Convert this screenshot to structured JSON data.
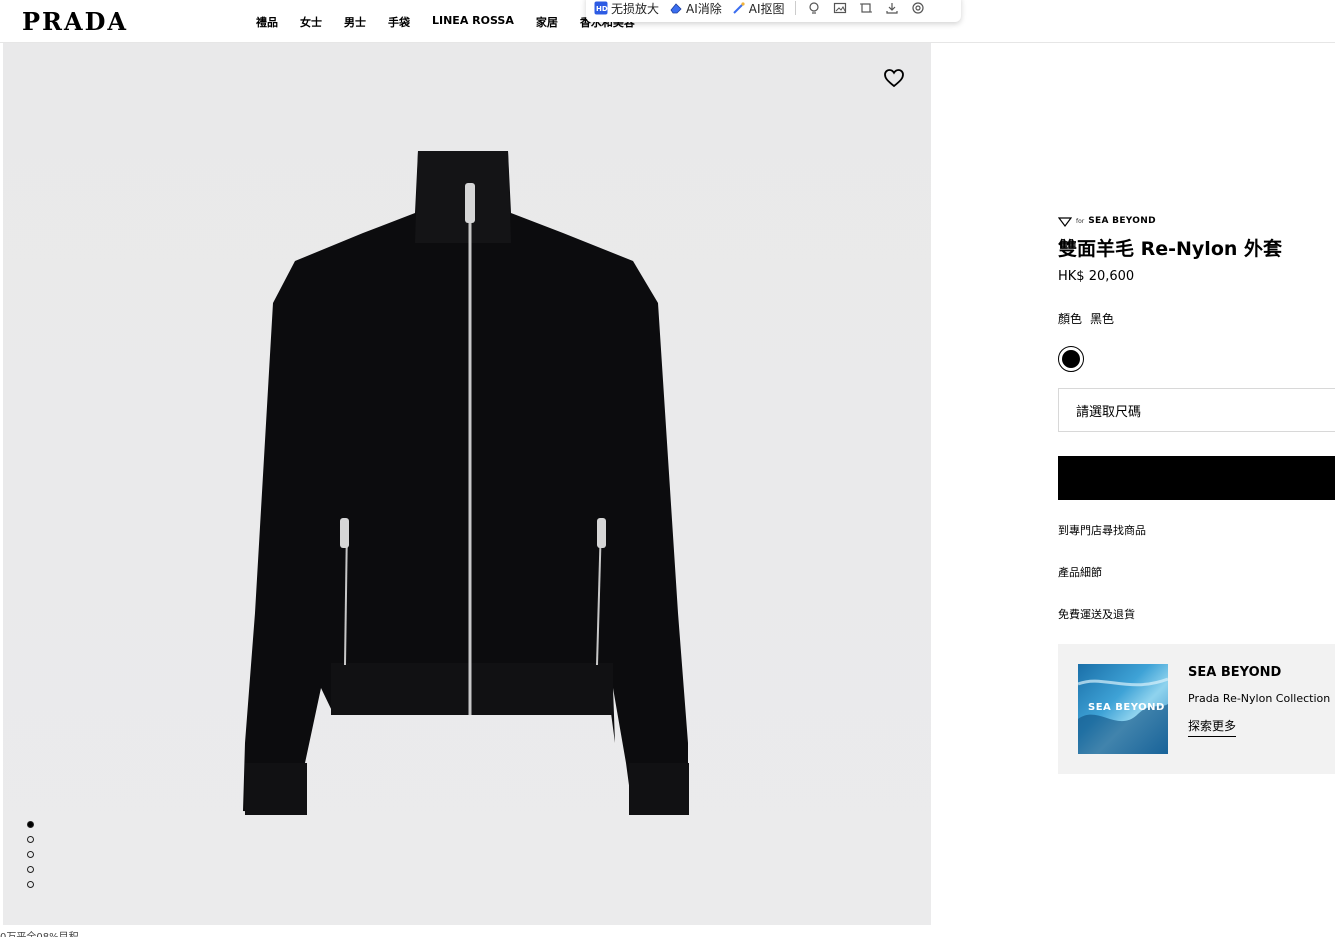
{
  "header": {
    "logo": "PRADA",
    "nav": [
      "禮品",
      "女士",
      "男士",
      "手袋",
      "LINEA ROSSA",
      "家居",
      "香水和美容"
    ]
  },
  "toolbar": {
    "buttons": [
      "无损放大",
      "AI消除",
      "AI抠图"
    ],
    "icons": [
      "bulb-icon",
      "image-icon",
      "crop-icon",
      "download-icon",
      "settings-icon"
    ]
  },
  "product": {
    "brand_tag_prefix": "for",
    "brand_tag": "SEA BEYOND",
    "title": "雙面羊毛 Re-Nylon 外套",
    "price": "HK$ 20,600",
    "color_label": "顏色",
    "color_value": "黑色",
    "swatch_color": "#000000",
    "size_placeholder": "請選取尺碼",
    "links": [
      "到專門店尋找商品",
      "產品細節",
      "免費運送及退貨"
    ]
  },
  "promo": {
    "image_text": "SEA BEYOND",
    "title": "SEA BEYOND",
    "subtitle": "Prada Re-Nylon Collection",
    "cta": "探索更多"
  },
  "gallery": {
    "dot_count": 5,
    "active_dot": 0
  },
  "footer": {
    "text": "0万平全08%目积"
  }
}
